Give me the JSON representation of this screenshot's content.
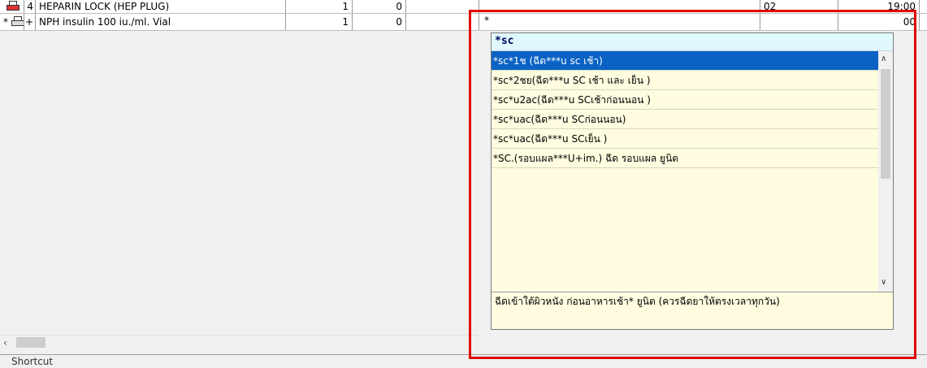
{
  "grid": {
    "rows": [
      {
        "mark": "",
        "num": "4",
        "name": "HEPARIN LOCK (HEP PLUG)",
        "qty": "1",
        "qty2": "0",
        "col_b": "02",
        "time": "19:00"
      },
      {
        "mark": "*",
        "num": "+",
        "name": "NPH insulin 100 iu./ml. Vial",
        "qty": "1",
        "qty2": "0",
        "col_b": "",
        "time": "00"
      }
    ],
    "behind_text": "*"
  },
  "popup": {
    "query": "*sc",
    "items": [
      "*sc*1ช (ฉีด***u sc เช้า)",
      "*sc*2ชย(ฉีด***u SC เช้า และ เย็น )",
      "*sc*u2ac(ฉีด***u SCเช้าก่อนนอน )",
      "*sc*uac(ฉีด***u SCก่อนนอน)",
      "*sc*uac(ฉีด***u SCเย็น )",
      "*SC.(รอบแผล***U+im.) ฉีด รอบแผล   ยูนิต"
    ],
    "selected_index": 0,
    "description": "ฉีดเข้าใต้ผิวหนัง ก่อนอาหารเช้า* ยูนิต (ควรฉีดยาให้ตรงเวลาทุกวัน)"
  },
  "status": {
    "shortcut_label": "Shortcut"
  },
  "icons": {
    "printer": "printer-icon",
    "printer_red": "printer-red-icon",
    "scroll_left": "chevron-left-icon",
    "scroll_up": "chevron-up-icon",
    "scroll_down": "chevron-down-icon"
  },
  "colors": {
    "highlight": "#e00000",
    "selected": "#0a62c4",
    "popup_bg": "#fffce0",
    "input_bg": "#dff8fd"
  }
}
